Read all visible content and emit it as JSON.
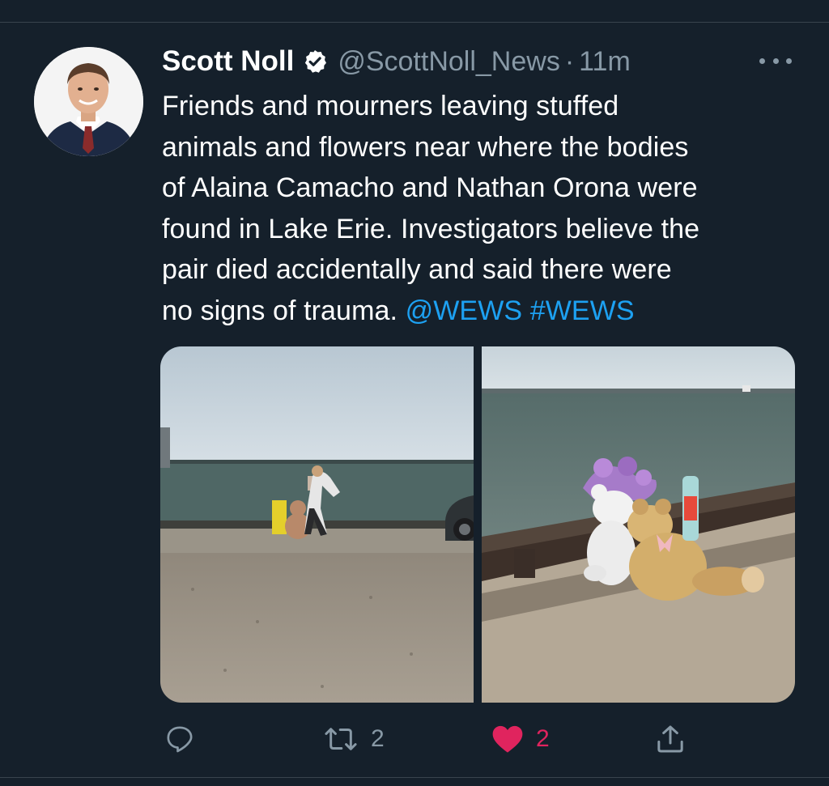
{
  "tweet": {
    "author": {
      "name": "Scott Noll",
      "handle": "@ScottNoll_News",
      "verified_icon": "verified-badge-icon"
    },
    "separator": "·",
    "time": "11m",
    "text_lines": [
      "Friends and mourners leaving stuffed",
      "animals and flowers near where the bodies",
      "of Alaina Camacho and Nathan Orona were",
      "found in Lake Erie. Investigators believe the",
      "pair died accidentally and said there were",
      "no signs of trauma."
    ],
    "mentions": [
      "@WEWS",
      "#WEWS"
    ],
    "actions": {
      "reply": {
        "icon": "reply-icon"
      },
      "retweet": {
        "icon": "retweet-icon",
        "count": "2"
      },
      "like": {
        "icon": "heart-icon",
        "count": "2",
        "liked": true
      },
      "share": {
        "icon": "share-icon"
      }
    }
  },
  "colors": {
    "background": "#15202b",
    "divider": "#38444d",
    "secondary_text": "#8899a6",
    "link": "#1da1f2",
    "like": "#e0245e"
  }
}
